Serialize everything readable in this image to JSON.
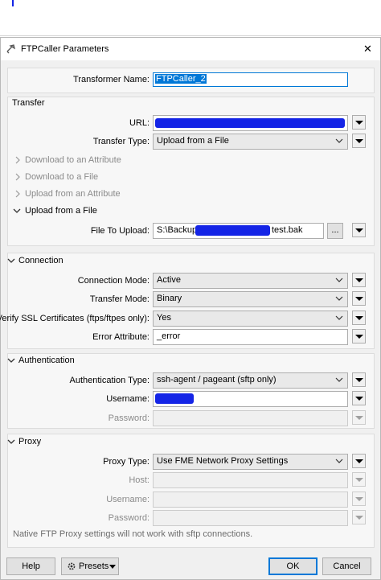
{
  "window": {
    "title": "FTPCaller Parameters",
    "close_glyph": "✕"
  },
  "transformer": {
    "label": "Transformer Name:",
    "value": "FTPCaller_2"
  },
  "transfer": {
    "title": "Transfer",
    "url_label": "URL:",
    "type_label": "Transfer Type:",
    "type_value": "Upload from a File",
    "sub_sections": [
      "Download to an Attribute",
      "Download to a File",
      "Upload from an Attribute"
    ],
    "upload_section_title": "Upload from a File",
    "file_label": "File To Upload:",
    "file_prefix": "S:\\Backup\\",
    "file_suffix": "test.bak",
    "browse_label": "..."
  },
  "connection": {
    "title": "Connection",
    "mode_label": "Connection Mode:",
    "mode_value": "Active",
    "transfer_mode_label": "Transfer Mode:",
    "transfer_mode_value": "Binary",
    "ssl_label": "Verify SSL Certificates (ftps/ftpes only):",
    "ssl_value": "Yes",
    "error_label": "Error Attribute:",
    "error_value": "_error"
  },
  "authentication": {
    "title": "Authentication",
    "type_label": "Authentication Type:",
    "type_value": "ssh-agent / pageant (sftp only)",
    "username_label": "Username:",
    "password_label": "Password:"
  },
  "proxy": {
    "title": "Proxy",
    "type_label": "Proxy Type:",
    "type_value": "Use FME Network Proxy Settings",
    "host_label": "Host:",
    "username_label": "Username:",
    "password_label": "Password:",
    "note": "Native FTP Proxy settings will not work with sftp connections."
  },
  "footer": {
    "help": "Help",
    "presets": "Presets",
    "ok": "OK",
    "cancel": "Cancel"
  },
  "colors": {
    "redaction": "#1424e6",
    "selection": "#0078d7"
  }
}
